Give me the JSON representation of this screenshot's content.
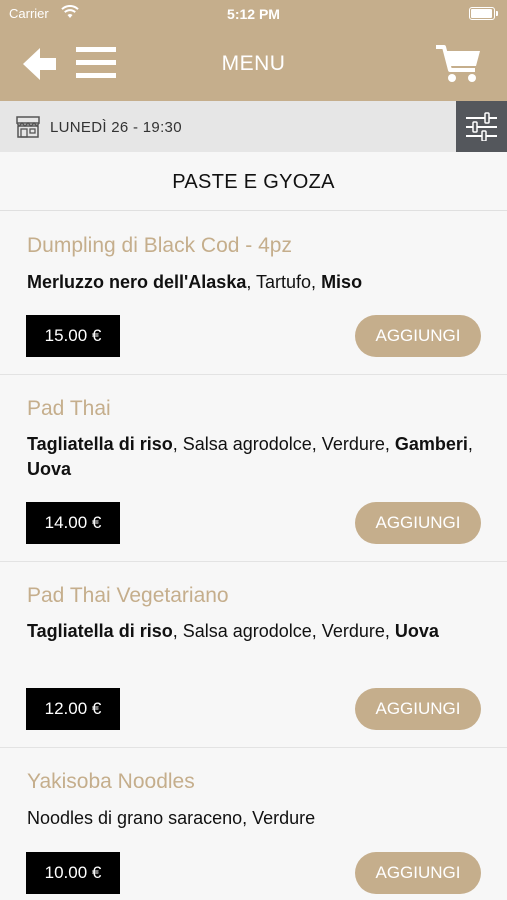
{
  "status": {
    "carrier": "Carrier",
    "time": "5:12 PM"
  },
  "header": {
    "title": "MENU"
  },
  "datebar": {
    "date": "LUNEDÌ 26 - 19:30"
  },
  "section": {
    "title": "PASTE E GYOZA"
  },
  "items": [
    {
      "name": "Dumpling di Black Cod - 4pz",
      "desc": [
        {
          "text": "Merluzzo nero dell'Alaska",
          "bold": true
        },
        {
          "text": ", Tartufo, ",
          "bold": false
        },
        {
          "text": "Miso",
          "bold": true
        }
      ],
      "price": "15.00 €",
      "add_label": "AGGIUNGI"
    },
    {
      "name": "Pad Thai",
      "desc": [
        {
          "text": "Tagliatella di riso",
          "bold": true
        },
        {
          "text": ", Salsa agrodolce, Verdure, ",
          "bold": false
        },
        {
          "text": "Gamberi",
          "bold": true
        },
        {
          "text": ", ",
          "bold": false
        },
        {
          "text": "Uova",
          "bold": true
        }
      ],
      "price": "14.00 €",
      "add_label": "AGGIUNGI"
    },
    {
      "name": "Pad Thai Vegetariano",
      "desc": [
        {
          "text": "Tagliatella di riso",
          "bold": true
        },
        {
          "text": ", Salsa agrodolce, Verdure, ",
          "bold": false
        },
        {
          "text": "Uova",
          "bold": true
        }
      ],
      "price": "12.00 €",
      "add_label": "AGGIUNGI"
    },
    {
      "name": "Yakisoba Noodles",
      "desc": [
        {
          "text": "Noodles di grano saraceno, Verdure",
          "bold": false
        }
      ],
      "price": "10.00 €",
      "add_label": "AGGIUNGI"
    }
  ],
  "colors": {
    "accent": "#c5ae8c",
    "filter_button": "#54575c",
    "price_bg": "#000000"
  },
  "icons": [
    "wifi-icon",
    "battery-icon",
    "back-arrow-icon",
    "hamburger-menu-icon",
    "cart-icon",
    "shop-icon",
    "filter-sliders-icon"
  ]
}
